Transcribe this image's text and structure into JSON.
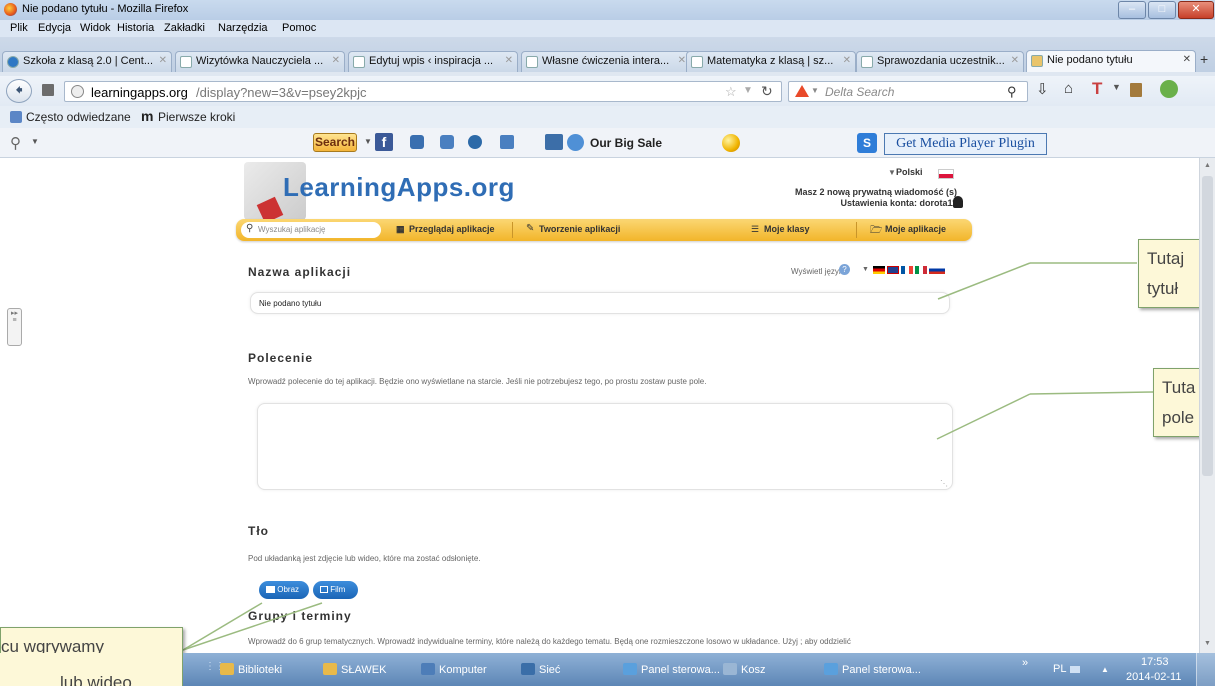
{
  "window": {
    "title": "Nie podano tytułu - Mozilla Firefox"
  },
  "menu": [
    "Plik",
    "Edycja",
    "Widok",
    "Historia",
    "Zakładki",
    "Narzędzia",
    "Pomoc"
  ],
  "tabs": [
    {
      "label": "Szkoła z klasą 2.0 | Cent..."
    },
    {
      "label": "Wizytówka Nauczyciela ..."
    },
    {
      "label": "Edytuj wpis ‹ inspiracja ..."
    },
    {
      "label": "Własne ćwiczenia intera..."
    },
    {
      "label": "Matematyka z klasą | sz..."
    },
    {
      "label": "Sprawozdania uczestnik..."
    },
    {
      "label": "Nie podano tytułu"
    }
  ],
  "nav": {
    "url_domain": "learningapps.org",
    "url_path": "/display?new=3&v=psey2kpjc",
    "search_placeholder": "Delta Search"
  },
  "bookmarks": {
    "item1": "Często odwiedzane",
    "item2": "Pierwsze kroki"
  },
  "addon": {
    "search_btn": "Search",
    "sale": "Our Big Sale",
    "plugin": "Get Media Player Plugin"
  },
  "site": {
    "logo": "LearningApps.org",
    "language": "Polski",
    "messages": "Masz 2 nową prywatną wiadomość (s)",
    "account": "Ustawienia konta: dorota11",
    "search_placeholder": "Wyszukaj aplikację",
    "nav_browse": "Przeglądaj aplikacje",
    "nav_create": "Tworzenie aplikacji",
    "nav_classes": "Moje klasy",
    "nav_apps": "Moje aplikacje"
  },
  "form": {
    "name_heading": "Nazwa aplikacji",
    "show_lang": "Wyświetl język",
    "name_value": "Nie podano tytułu",
    "task_heading": "Polecenie",
    "task_hint": "Wprowadź polecenie do tej aplikacji. Będzie ono wyświetlane na starcie. Jeśli nie potrzebujesz tego, po prostu zostaw puste pole.",
    "bg_heading": "Tło",
    "bg_hint": "Pod układanką jest zdjęcie lub wideo, które ma zostać odsłonięte.",
    "btn_image": "Obraz",
    "btn_film": "Film",
    "groups_heading": "Grupy i terminy",
    "groups_hint": "Wprowadź do 6 grup tematycznych. Wprowadź indywidualne terminy, które należą do każdego tematu. Będą one rozmieszczone losowo w układance. Użyj ; aby oddzielić"
  },
  "callouts": {
    "c1_line1": "Tutaj",
    "c1_line2": "tytuł",
    "c2_line1": "Tuta",
    "c2_line2": "pole",
    "c3_line1": "cu wgrywamy",
    "c3_line2": "lub wideo"
  },
  "taskbar": {
    "items": [
      "Biblioteki",
      "SŁAWEK",
      "Komputer",
      "Sieć",
      "Panel sterowa...",
      "Kosz",
      "Panel sterowa..."
    ],
    "lang": "PL",
    "time": "17:53",
    "date": "2014-02-11"
  },
  "colors": {
    "accent": "#f7c542",
    "logo_blue": "#2f6db5",
    "callout_bg": "#fdf8d8",
    "callout_border": "#7fa26b"
  }
}
